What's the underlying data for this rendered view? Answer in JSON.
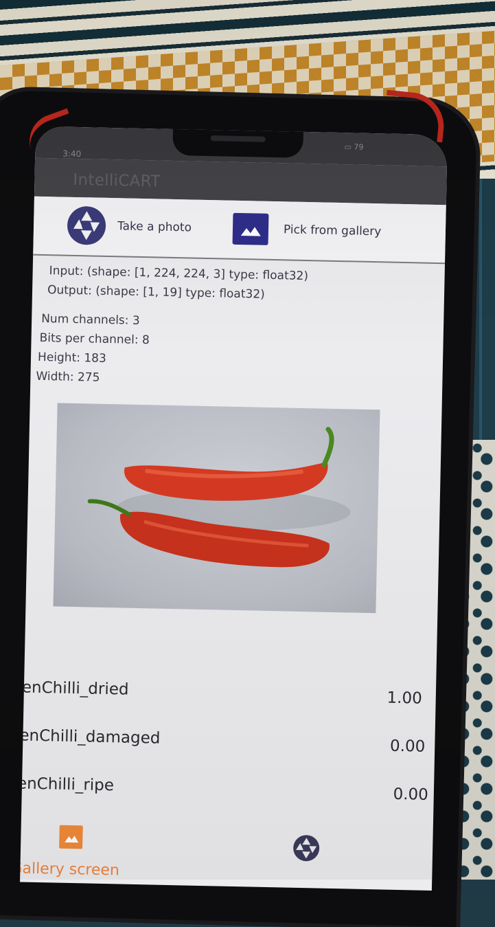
{
  "status": {
    "time": "3:40",
    "battery": "79"
  },
  "app": {
    "title": "IntelliCART"
  },
  "actions": {
    "take_photo": "Take a photo",
    "pick_gallery": "Pick from gallery"
  },
  "model_info": {
    "input": "Input: (shape: [1, 224, 224, 3] type: float32)",
    "output": "Output: (shape: [1, 19] type: float32)"
  },
  "image_info": {
    "channels": "Num channels: 3",
    "bits": "Bits per channel: 8",
    "height": "Height: 183",
    "width": "Width: 275"
  },
  "results": [
    {
      "label": "GreenChilli_dried",
      "value": "1.00"
    },
    {
      "label": "GreenChilli_damaged",
      "value": "0.00"
    },
    {
      "label": "GreenChilli_ripe",
      "value": "0.00"
    }
  ],
  "nav": {
    "gallery_label": "Gallery screen"
  },
  "colors": {
    "accent": "#f08a3a",
    "primary_icon": "#2e2e8c"
  }
}
